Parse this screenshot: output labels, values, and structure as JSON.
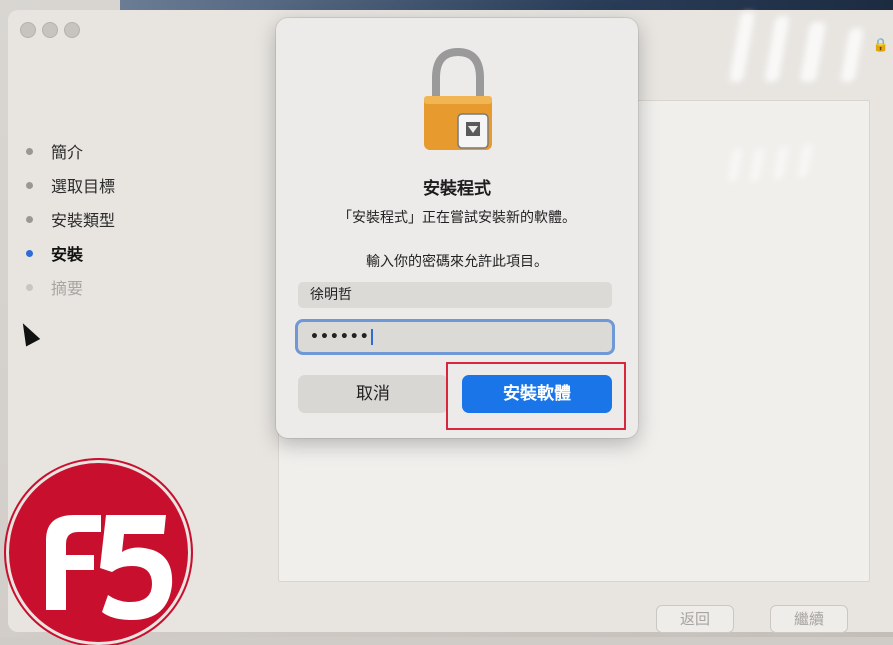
{
  "window": {
    "sidebar_steps": [
      {
        "label": "簡介",
        "state": "done"
      },
      {
        "label": "選取目標",
        "state": "done"
      },
      {
        "label": "安裝類型",
        "state": "done"
      },
      {
        "label": "安裝",
        "state": "current"
      },
      {
        "label": "摘要",
        "state": "pending"
      }
    ],
    "footer": {
      "back_label": "返回",
      "continue_label": "繼續"
    }
  },
  "dialog": {
    "title": "安裝程式",
    "message": "「安裝程式」正在嘗試安裝新的軟體。",
    "prompt": "輸入你的密碼來允許此項目。",
    "username": "徐明哲",
    "password_masked": "••••••",
    "cancel_label": "取消",
    "install_label": "安裝軟體"
  },
  "colors": {
    "accent": "#1a75e8",
    "current_step_dot": "#2f6bd6",
    "highlight_box": "#d7263d",
    "f5_red": "#c8102e"
  }
}
